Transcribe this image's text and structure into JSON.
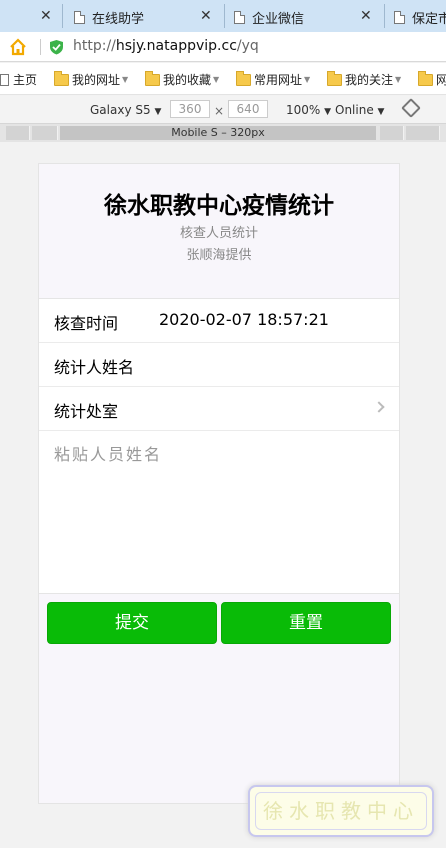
{
  "browser": {
    "tabs": [
      {
        "label": "在线助学"
      },
      {
        "label": "企业微信"
      },
      {
        "label": "保定市"
      }
    ],
    "address": {
      "scheme": "http://",
      "host": "hsjy.natappvip.cc",
      "path": "/yq"
    },
    "bookmarks": [
      {
        "label": "主页"
      },
      {
        "label": "我的网址"
      },
      {
        "label": "我的收藏"
      },
      {
        "label": "常用网址"
      },
      {
        "label": "我的关注"
      },
      {
        "label": "网"
      }
    ],
    "devtools": {
      "device": "Galaxy S5",
      "width": "360",
      "height": "640",
      "times": "×",
      "zoom": "100%",
      "network": "Online",
      "media_label": "Mobile S – 320px"
    }
  },
  "page": {
    "title": "徐水职教中心疫情统计",
    "subtitle": "核查人员统计",
    "provider": "张顺海提供",
    "form": {
      "check_time_label": "核查时间",
      "check_time_value": "2020-02-07 18:57:21",
      "name_label": "统计人姓名",
      "office_label": "统计处室",
      "paste_placeholder": "粘贴人员姓名"
    },
    "submit_label": "提交",
    "reset_label": "重置",
    "watermark": "徐水职教中心"
  },
  "colors": {
    "accent_green": "#09bb07",
    "tab_bar": "#cfe3f5"
  },
  "icons": [
    "close-icon",
    "page-icon",
    "home-icon",
    "shield-icon",
    "folder-icon",
    "rotate-icon",
    "chevron-right-icon"
  ]
}
